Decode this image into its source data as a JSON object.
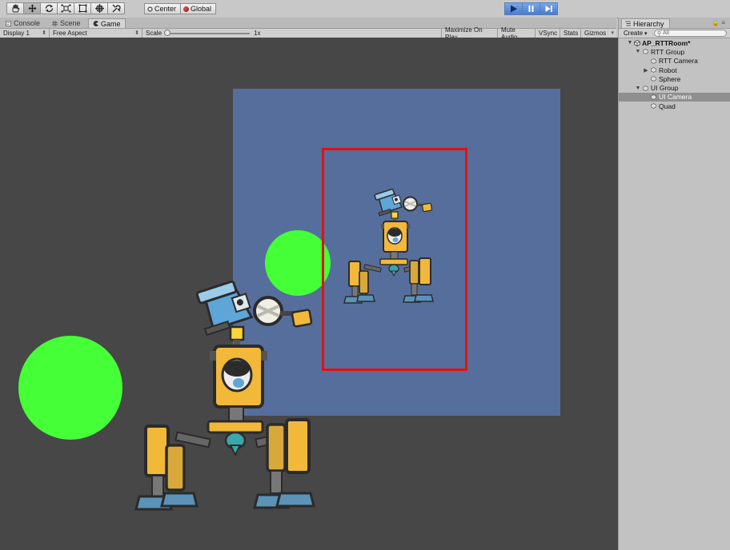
{
  "toolbar": {
    "tools": [
      {
        "name": "hand-tool",
        "active": false
      },
      {
        "name": "move-tool",
        "active": true
      },
      {
        "name": "rotate-tool",
        "active": false
      },
      {
        "name": "scale-tool",
        "active": false
      },
      {
        "name": "rect-tool",
        "active": false
      },
      {
        "name": "transform-tool",
        "active": false
      },
      {
        "name": "custom-tool",
        "active": false
      }
    ],
    "pivot_label": "Center",
    "space_label": "Global",
    "play_state": "playing"
  },
  "game_panel": {
    "tabs": [
      {
        "label": "Console",
        "icon": "console-icon",
        "active": false
      },
      {
        "label": "Scene",
        "icon": "scene-grid-icon",
        "active": false
      },
      {
        "label": "Game",
        "icon": "game-pacman-icon",
        "active": true
      }
    ],
    "gamebar": {
      "display": "Display 1",
      "aspect": "Free Aspect",
      "scale_label": "Scale",
      "scale_value": "1x",
      "maximize": "Maximize On Play",
      "mute": "Mute Audio",
      "vsync": "VSync",
      "stats": "Stats",
      "gizmos": "Gizmos"
    }
  },
  "viewport": {
    "background": "#474747",
    "quad_color": "#566e9b",
    "sphere_color": "#45ff37",
    "selection_color": "#e80f0f"
  },
  "hierarchy": {
    "tab_label": "Hierarchy",
    "create_label": "Create",
    "search_placeholder": "All",
    "scene_name": "AP_RTTRoom*",
    "items": [
      {
        "label": "RTT Group",
        "depth": 1,
        "arrow": "expanded",
        "selected": false
      },
      {
        "label": "RTT Camera",
        "depth": 2,
        "arrow": "none",
        "selected": false
      },
      {
        "label": "Robot",
        "depth": 2,
        "arrow": "collapsed",
        "selected": false
      },
      {
        "label": "Sphere",
        "depth": 2,
        "arrow": "none",
        "selected": false
      },
      {
        "label": "UI Group",
        "depth": 1,
        "arrow": "expanded",
        "selected": false
      },
      {
        "label": "UI Camera",
        "depth": 2,
        "arrow": "none",
        "selected": true
      },
      {
        "label": "Quad",
        "depth": 2,
        "arrow": "none",
        "selected": false
      }
    ]
  }
}
